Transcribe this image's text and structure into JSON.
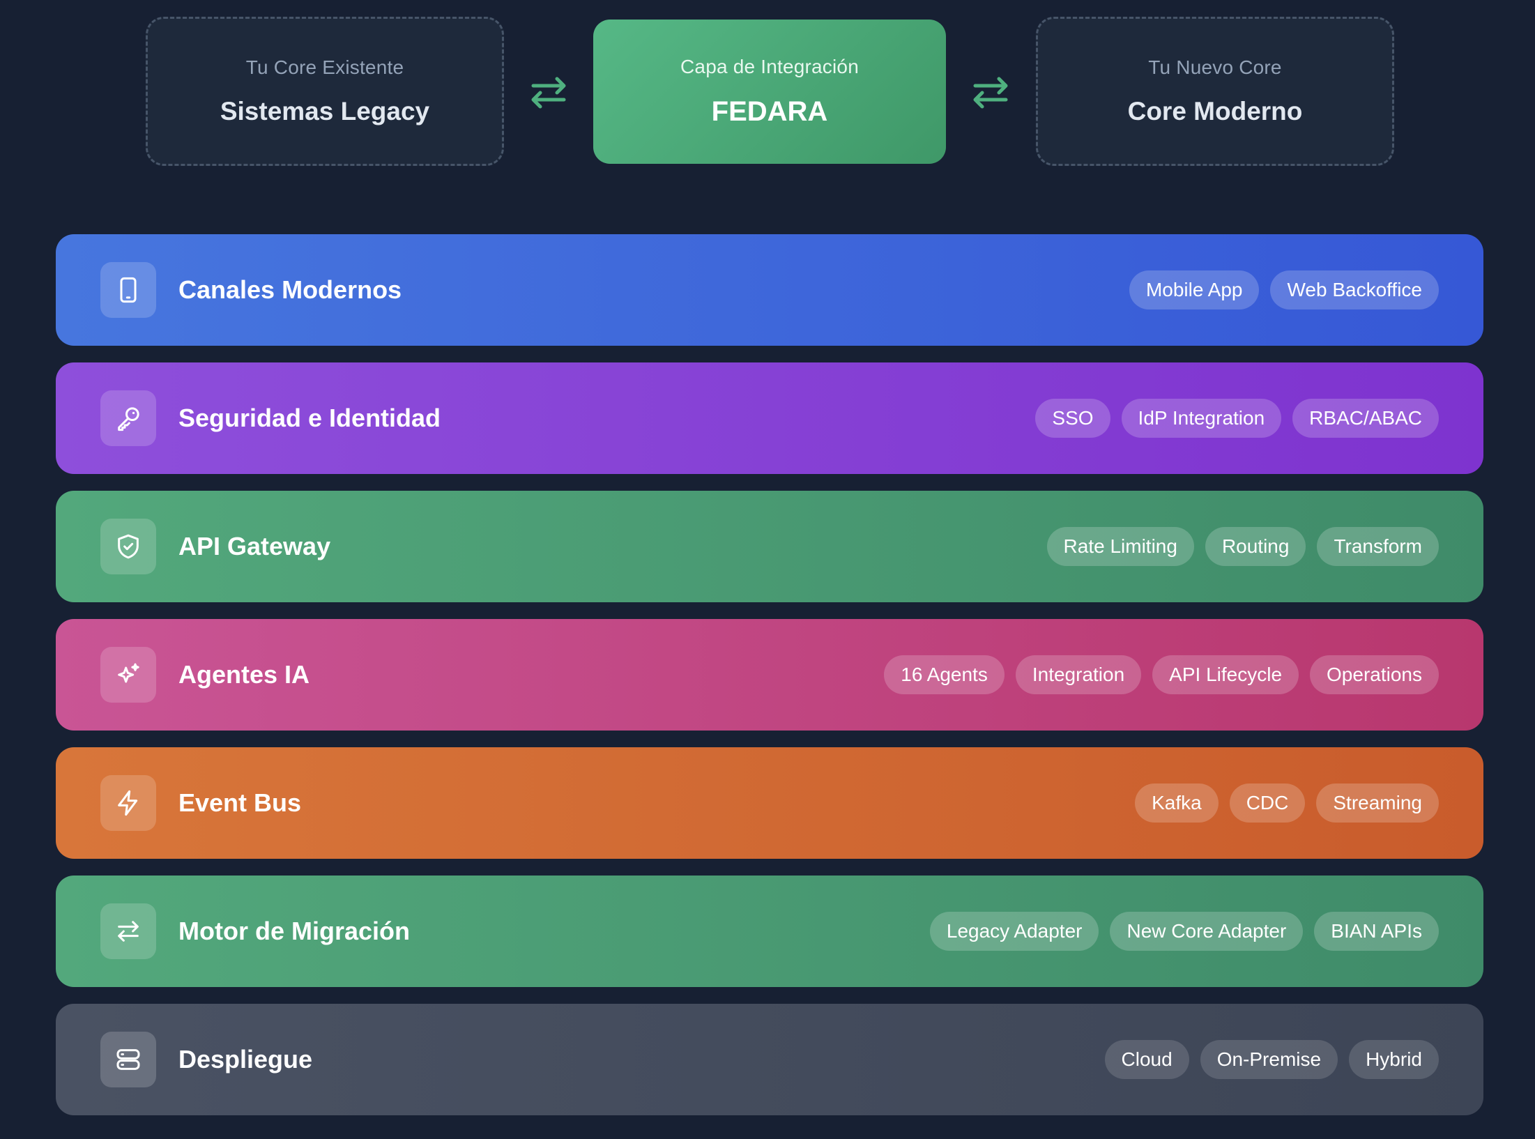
{
  "integration": {
    "legacy": {
      "subtitle": "Tu Core Existente",
      "title": "Sistemas Legacy"
    },
    "center": {
      "subtitle": "Capa de Integración",
      "title": "FEDARA"
    },
    "modern": {
      "subtitle": "Tu Nuevo Core",
      "title": "Core Moderno"
    },
    "arrow_icon": "swap-arrows-icon",
    "accent_color": "#4fb07f"
  },
  "layers": [
    {
      "title": "Canales Modernos",
      "icon": "smartphone-icon",
      "color": "#4171dc",
      "tags": [
        "Mobile App",
        "Web Backoffice"
      ]
    },
    {
      "title": "Seguridad e Identidad",
      "icon": "key-icon",
      "color": "#8a45d8",
      "tags": [
        "SSO",
        "IdP Integration",
        "RBAC/ABAC"
      ]
    },
    {
      "title": "API Gateway",
      "icon": "shield-check-icon",
      "color": "#4c9f75",
      "tags": [
        "Rate Limiting",
        "Routing",
        "Transform"
      ]
    },
    {
      "title": "Agentes IA",
      "icon": "sparkles-icon",
      "color": "#c24985",
      "tags": [
        "16 Agents",
        "Integration",
        "API Lifecycle",
        "Operations"
      ]
    },
    {
      "title": "Event Bus",
      "icon": "zap-icon",
      "color": "#d26c34",
      "tags": [
        "Kafka",
        "CDC",
        "Streaming"
      ]
    },
    {
      "title": "Motor de Migración",
      "icon": "arrow-left-right-icon",
      "color": "#4c9f75",
      "tags": [
        "Legacy Adapter",
        "New Core Adapter",
        "BIAN APIs"
      ]
    },
    {
      "title": "Despliegue",
      "icon": "server-icon",
      "color": "#444b5c",
      "tags": [
        "Cloud",
        "On-Premise",
        "Hybrid"
      ]
    }
  ]
}
